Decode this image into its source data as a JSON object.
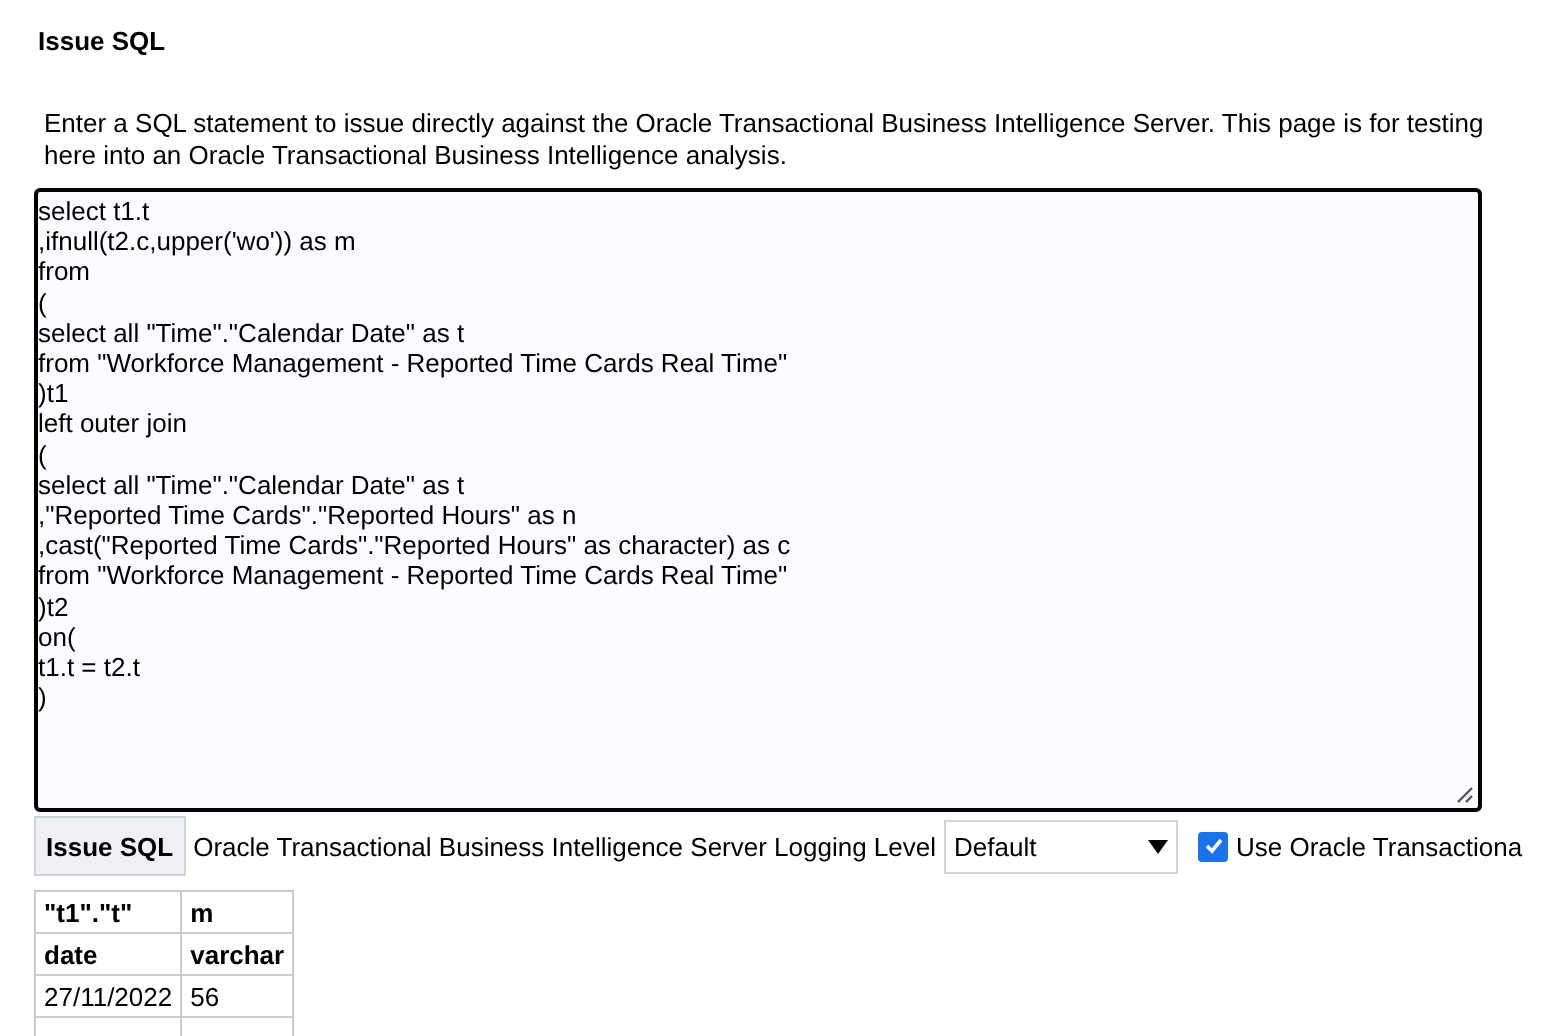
{
  "title": "Issue SQL",
  "description_lines": [
    "Enter a SQL statement to issue directly against the Oracle Transactional Business Intelligence Server. This page is for testing",
    "here into an Oracle Transactional Business Intelligence analysis."
  ],
  "sql_lines": [
    "select t1.t",
    ",ifnull(t2.c,upper('wo')) as m",
    "from",
    "(",
    "select all \"Time\".\"Calendar Date\" as t",
    "from \"Workforce Management - Reported Time Cards Real Time\"",
    ")t1",
    "left outer join",
    "(",
    "select all \"Time\".\"Calendar Date\" as t",
    ",\"Reported Time Cards\".\"Reported Hours\" as n",
    ",cast(\"Reported Time Cards\".\"Reported Hours\" as character) as c",
    "from \"Workforce Management - Reported Time Cards Real Time\"",
    ")t2",
    "on(",
    "t1.t = t2.t",
    ")"
  ],
  "issue_button": "Issue SQL",
  "logging_label": "Oracle Transactional Business Intelligence Server Logging Level",
  "logging_select": {
    "value": "Default"
  },
  "option_checkbox": {
    "label": "Use Oracle Transactiona",
    "checked": true
  },
  "results": {
    "columns": [
      {
        "name": "\"t1\".\"t\"",
        "type": "date"
      },
      {
        "name": "m",
        "type": "varchar"
      }
    ],
    "rows": [
      [
        "27/11/2022",
        "56"
      ],
      [
        "",
        ""
      ]
    ]
  }
}
